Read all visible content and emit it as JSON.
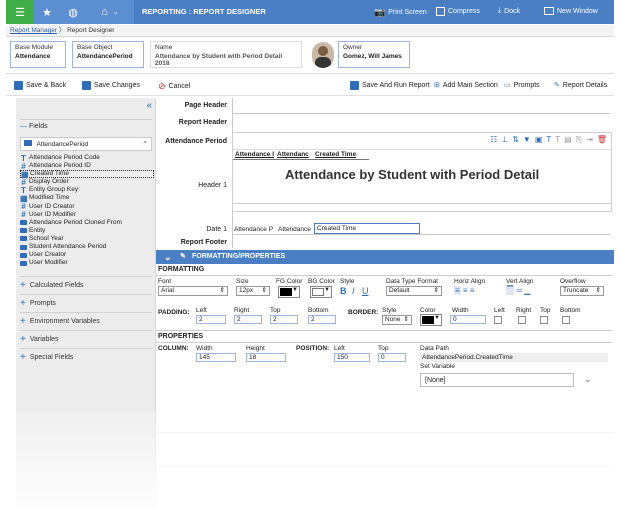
{
  "topbar": {
    "title": "REPORTING : REPORT DESIGNER",
    "print_screen": "Print Screen",
    "compress": "Compress",
    "dock": "Dock",
    "new_window": "New Window"
  },
  "breadcrumb": {
    "parent": "Report Manager",
    "current": "Report Designer"
  },
  "header": {
    "base_module_label": "Base Module",
    "base_module_value": "Attendance",
    "base_object_label": "Base Object",
    "base_object_value": "AttendancePeriod",
    "name_label": "Name",
    "name_value": "Attendance by Student with Period Detail 2018",
    "owner_label": "Owner",
    "owner_value": "Gomez, Will James"
  },
  "toolbar": {
    "save_back": "Save & Back",
    "save_changes": "Save Changes",
    "cancel": "Cancel",
    "save_run": "Save And Run Report",
    "add_main_section": "Add Main Section",
    "prompts": "Prompts",
    "report_details": "Report Details"
  },
  "left": {
    "fields_label": "Fields",
    "search_value": "AttendancePeriod",
    "fields": [
      {
        "icon": "T",
        "label": "Attendance Period Code"
      },
      {
        "icon": "#",
        "label": "Attendance Period ID"
      },
      {
        "icon": "cal",
        "label": "Created Time"
      },
      {
        "icon": "#",
        "label": "Display Order"
      },
      {
        "icon": "T",
        "label": "Entity Group Key"
      },
      {
        "icon": "cal",
        "label": "Modified Time"
      },
      {
        "icon": "#",
        "label": "User ID Creator"
      },
      {
        "icon": "#",
        "label": "User ID Modifier"
      },
      {
        "icon": "folder",
        "label": "Attendance Period Cloned From"
      },
      {
        "icon": "folder",
        "label": "Entity"
      },
      {
        "icon": "folder",
        "label": "School Year"
      },
      {
        "icon": "folder",
        "label": "Student Attendance Period"
      },
      {
        "icon": "folder",
        "label": "User Creator"
      },
      {
        "icon": "folder",
        "label": "User Modifier"
      }
    ],
    "sections": [
      "Calculated Fields",
      "Prompts",
      "Environment Variables",
      "Variables",
      "Special Fields"
    ]
  },
  "canvas": {
    "page_header": "Page Header",
    "report_header": "Report Header",
    "attendance_period": "Attendance Period",
    "header1": "Header 1",
    "date1": "Date 1",
    "report_footer": "Report Footer",
    "title_text": "Attendance by Student with Period Detail",
    "col_a": "Attendance I",
    "col_b": "Attendanc",
    "col_c": "Created Time",
    "data_a": "Attendance P",
    "data_b": "Attendance",
    "data_c": "Created Time"
  },
  "formatting": {
    "panel_title": "FORMATTING/PROPERTIES",
    "section": "FORMATTING",
    "font_label": "Font",
    "font_value": "Arial",
    "size_label": "Size",
    "size_value": "12px",
    "fg_label": "FG Color",
    "bg_label": "BG Color",
    "style_label": "Style",
    "style_b": "B",
    "style_i": "I",
    "style_u": "U",
    "dtf_label": "Data Type Format",
    "dtf_value": "Default",
    "halign_label": "Horiz Align",
    "valign_label": "Vert Align",
    "overflow_label": "Overflow",
    "overflow_value": "Truncate",
    "padding_label": "PADDING:",
    "left_label": "Left",
    "right_label": "Right",
    "top_label": "Top",
    "bottom_label": "Bottom",
    "pad_left": "2",
    "pad_right": "2",
    "pad_top": "2",
    "pad_bottom": "2",
    "border_label": "BORDER:",
    "border_style_label": "Style",
    "border_style_value": "None",
    "color_label": "Color",
    "width_label": "Width",
    "border_width": "0",
    "b_left": "Left",
    "b_right": "Right",
    "b_top": "Top",
    "b_bottom": "Bottom"
  },
  "properties": {
    "section": "PROPERTIES",
    "column_label": "COLUMN:",
    "width_label": "Width",
    "width_value": "145",
    "height_label": "Height",
    "height_value": "18",
    "position_label": "POSITION:",
    "left_label": "Left",
    "left_value": "150",
    "top_label": "Top",
    "top_value": "0",
    "path_label": "Data Path",
    "path_value": "AttendancePeriod.CreatedTime",
    "setvar_label": "Set Variable",
    "setvar_value": "[None]"
  }
}
